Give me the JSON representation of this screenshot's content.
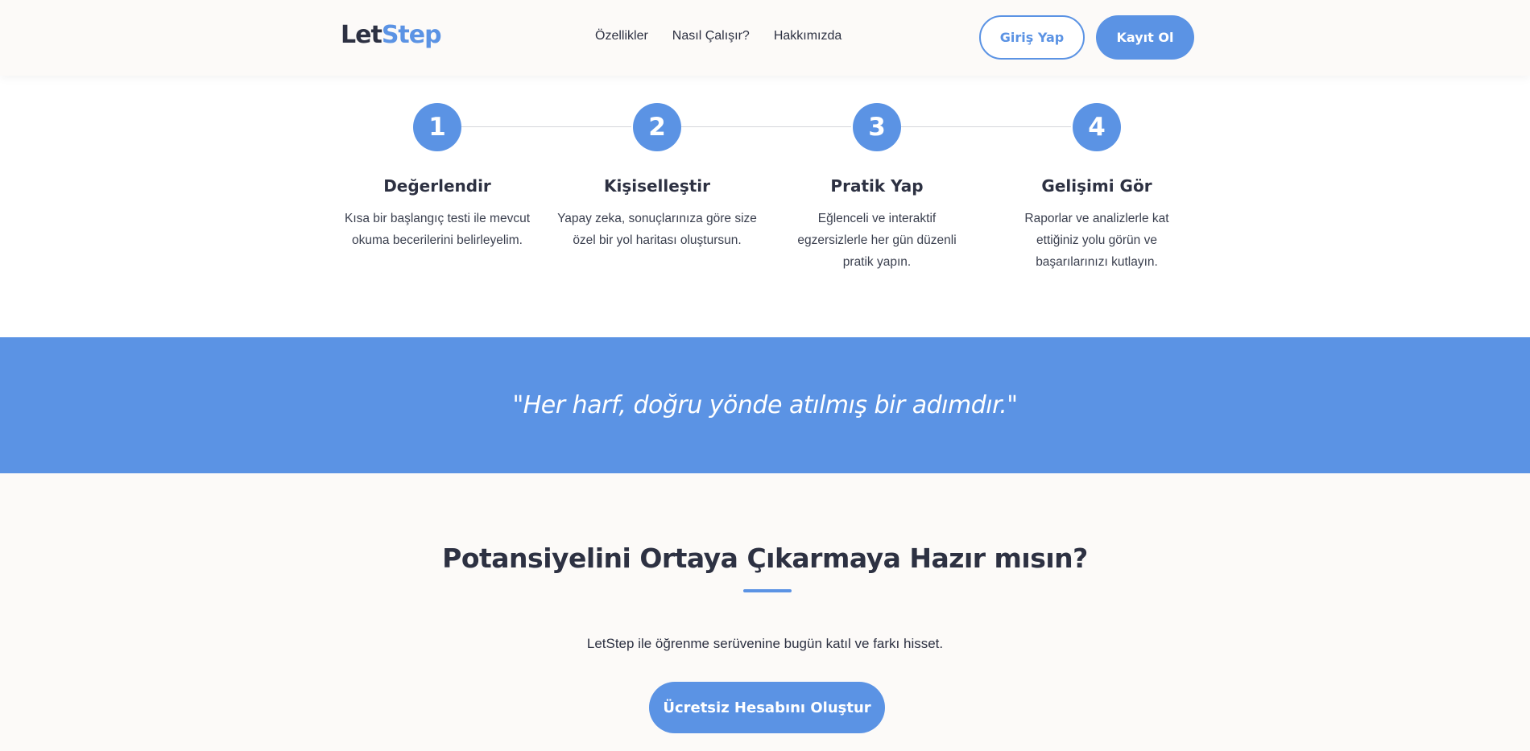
{
  "header": {
    "logo_part1": "Let",
    "logo_part2": "Step",
    "nav": [
      "Özellikler",
      "Nasıl Çalışır?",
      "Hakkımızda"
    ],
    "login_label": "Giriş Yap",
    "register_label": "Kayıt Ol"
  },
  "steps": [
    {
      "number": "1",
      "title": "Değerlendir",
      "desc": "Kısa bir başlangıç testi ile mevcut okuma becerilerini belirleyelim."
    },
    {
      "number": "2",
      "title": "Kişiselleştir",
      "desc": "Yapay zeka, sonuçlarınıza göre size özel bir yol haritası oluştursun."
    },
    {
      "number": "3",
      "title": "Pratik Yap",
      "desc": "Eğlenceli ve interaktif egzersizlerle her gün düzenli pratik yapın."
    },
    {
      "number": "4",
      "title": "Gelişimi Gör",
      "desc": "Raporlar ve analizlerle kat ettiğiniz yolu görün ve başarılarınızı kutlayın."
    }
  ],
  "quote": "\"Her harf, doğru yönde atılmış bir adımdır.\"",
  "cta": {
    "title": "Potansiyelini Ortaya Çıkarmaya Hazır mısın?",
    "subtitle": "LetStep ile öğrenme serüvenine bugün katıl ve farkı hisset.",
    "button_label": "Ücretsiz Hesabını Oluştur"
  },
  "colors": {
    "accent": "#5b93e4",
    "text": "#2d3142",
    "background": "#fcfaf8"
  }
}
